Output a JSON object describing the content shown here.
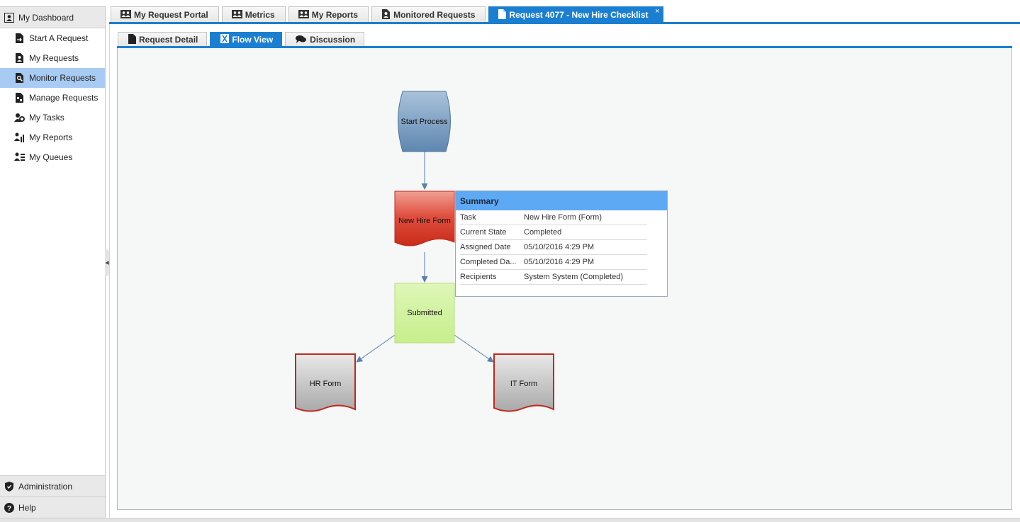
{
  "sidebar": {
    "header": {
      "label": "My Dashboard",
      "icon": "dashboard-icon"
    },
    "items": [
      {
        "label": "Start A Request",
        "icon": "start-request-icon",
        "active": false
      },
      {
        "label": "My Requests",
        "icon": "my-requests-icon",
        "active": false
      },
      {
        "label": "Monitor Requests",
        "icon": "monitor-requests-icon",
        "active": true
      },
      {
        "label": "Manage Requests",
        "icon": "manage-requests-icon",
        "active": false
      },
      {
        "label": "My Tasks",
        "icon": "tasks-icon",
        "active": false
      },
      {
        "label": "My Reports",
        "icon": "reports-icon",
        "active": false
      },
      {
        "label": "My Queues",
        "icon": "queues-icon",
        "active": false
      }
    ],
    "footer": [
      {
        "label": "Administration",
        "icon": "shield-icon"
      },
      {
        "label": "Help",
        "icon": "help-icon"
      }
    ]
  },
  "top_tabs": [
    {
      "label": "My Request Portal",
      "active": false
    },
    {
      "label": "Metrics",
      "active": false
    },
    {
      "label": "My Reports",
      "active": false
    },
    {
      "label": "Monitored Requests",
      "active": false
    },
    {
      "label": "Request 4077 - New Hire Checklist",
      "active": true,
      "close": "×"
    }
  ],
  "sub_tabs": [
    {
      "label": "Request Detail",
      "active": false
    },
    {
      "label": "Flow View",
      "active": true
    },
    {
      "label": "Discussion",
      "active": false
    }
  ],
  "flow": {
    "nodes": {
      "start": "Start Process",
      "new_hire_form": "New Hire Form",
      "submitted": "Submitted",
      "hr_form": "HR Form",
      "it_form": "IT Form"
    }
  },
  "summary": {
    "title": "Summary",
    "rows": [
      {
        "key": "Task",
        "value": "New Hire Form (Form)"
      },
      {
        "key": "Current State",
        "value": "Completed"
      },
      {
        "key": "Assigned Date",
        "value": "05/10/2016 4:29 PM"
      },
      {
        "key": "Completed Da...",
        "value": "05/10/2016 4:29 PM"
      },
      {
        "key": "Recipients",
        "value": "System System (Completed)"
      }
    ]
  },
  "colors": {
    "accent": "#1b7fd1",
    "active_sidebar": "#a8cbf3",
    "start_node": "#6e95bb",
    "form_completed": "#d9382a",
    "submitted_node": "#ccf093",
    "pending_form": "#bdbdbd",
    "pending_border": "#c0281c"
  }
}
